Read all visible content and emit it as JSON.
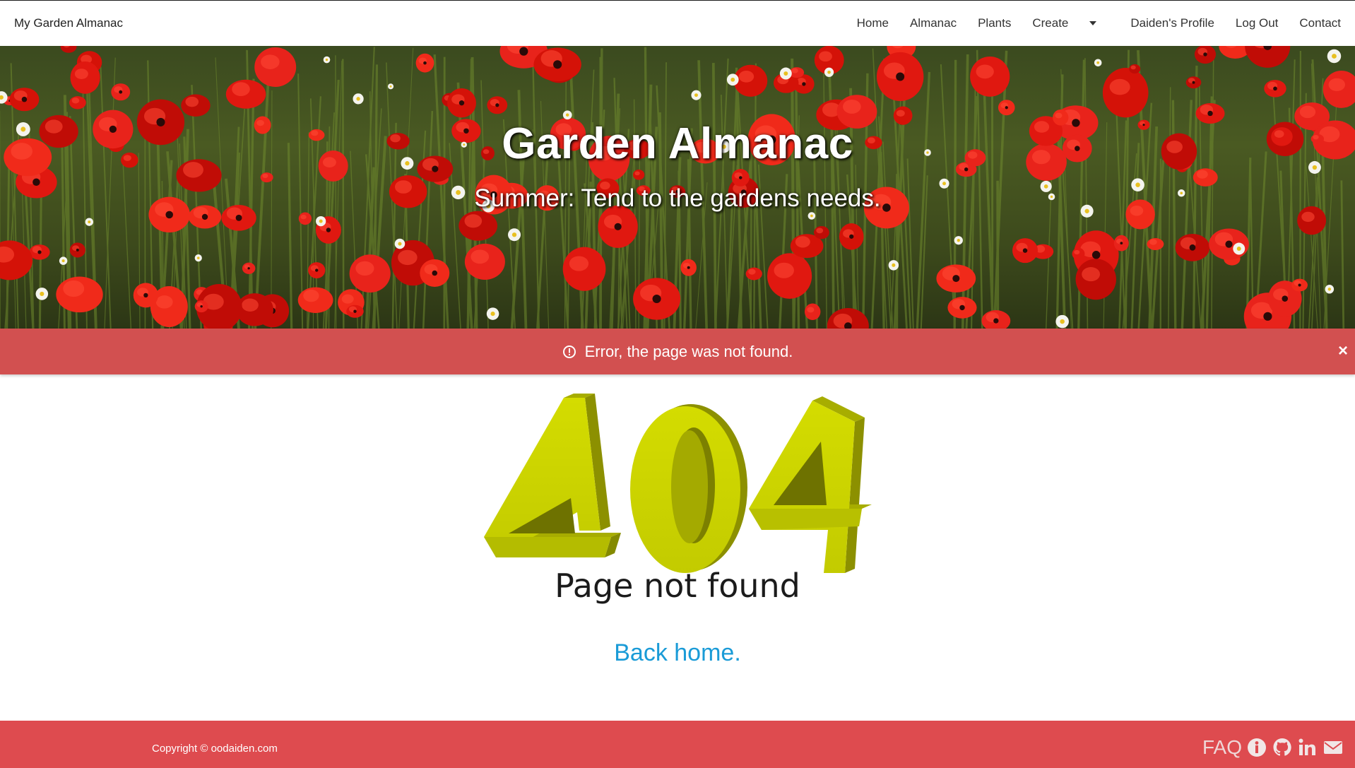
{
  "nav": {
    "brand": "My Garden Almanac",
    "links": [
      "Home",
      "Almanac",
      "Plants",
      "Create",
      "Daiden's Profile",
      "Log Out",
      "Contact"
    ]
  },
  "hero": {
    "title": "Garden Almanac",
    "subtitle": "Summer: Tend to the gardens needs."
  },
  "alert": {
    "message": "Error, the page was not found.",
    "close": "×",
    "color": "#d25050"
  },
  "error_graphic": {
    "code": "404",
    "caption": "Page not found",
    "color": "#c8d400"
  },
  "back_home": "Back home.",
  "footer": {
    "copyright": "Copyright © oodaiden.com",
    "faq": "FAQ",
    "icons": [
      "info-icon",
      "github-icon",
      "linkedin-icon",
      "mail-icon"
    ],
    "color": "#de4b4f"
  }
}
